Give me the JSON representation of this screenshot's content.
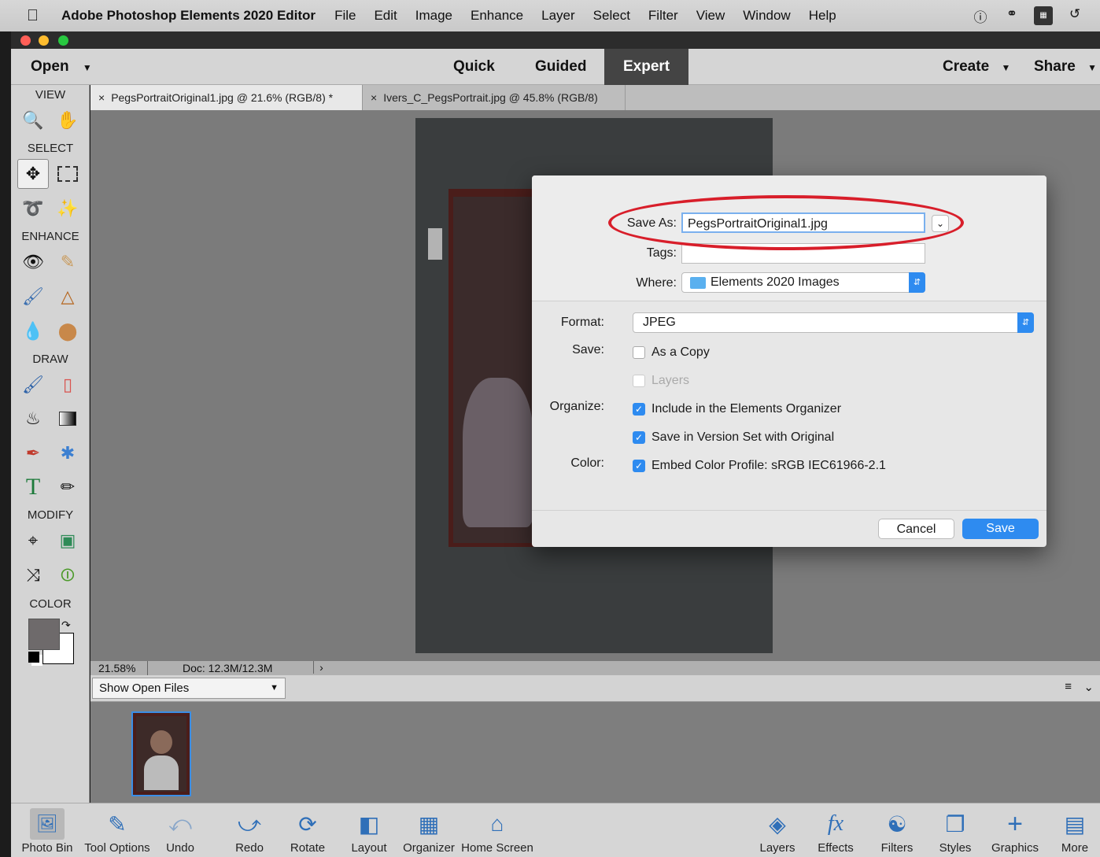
{
  "menubar": {
    "apple_icon": "apple-icon",
    "app_name": "Adobe Photoshop Elements 2020 Editor",
    "items": [
      "File",
      "Edit",
      "Image",
      "Enhance",
      "Layer",
      "Select",
      "Filter",
      "View",
      "Window",
      "Help"
    ],
    "status_icons": [
      "password-icon",
      "creative-cloud-icon",
      "app-icon",
      "time-machine-icon"
    ]
  },
  "window": {
    "traffic_lights": {
      "close": "#ff5f57",
      "minimize": "#febc2e",
      "zoom": "#28c840"
    }
  },
  "modebar": {
    "open_label": "Open",
    "modes": [
      "Quick",
      "Guided",
      "Expert"
    ],
    "active_mode": "Expert",
    "create_label": "Create",
    "share_label": "Share"
  },
  "toolbox": {
    "sections": {
      "view": "VIEW",
      "select": "SELECT",
      "enhance": "ENHANCE",
      "draw": "DRAW",
      "modify": "MODIFY",
      "color": "COLOR"
    },
    "colors": {
      "foreground": "#6e6a6b",
      "background": "#ffffff"
    }
  },
  "tabs": [
    {
      "close": "×",
      "label": "PegsPortraitOriginal1.jpg @ 21.6% (RGB/8) *"
    },
    {
      "close": "×",
      "label": "Ivers_C_PegsPortrait.jpg @ 45.8% (RGB/8)"
    }
  ],
  "status": {
    "zoom": "21.58%",
    "doc": "Doc: 12.3M/12.3M"
  },
  "bin": {
    "dropdown": "Show Open Files"
  },
  "bottombar": {
    "left": [
      "Photo Bin",
      "Tool Options",
      "Undo",
      "Redo",
      "Rotate",
      "Layout",
      "Organizer",
      "Home Screen"
    ],
    "right": [
      "Layers",
      "Effects",
      "Filters",
      "Styles",
      "Graphics",
      "More"
    ]
  },
  "dialog": {
    "save_as_label": "Save As:",
    "save_as_value": "PegsPortraitOriginal1.jpg",
    "tags_label": "Tags:",
    "tags_value": "",
    "where_label": "Where:",
    "where_value": "Elements 2020 Images",
    "format_label": "Format:",
    "format_value": "JPEG",
    "save_label": "Save:",
    "as_copy": {
      "label": "As a Copy",
      "checked": false
    },
    "layers": {
      "label": "Layers",
      "checked": false
    },
    "organize_label": "Organize:",
    "include_organizer": {
      "label": "Include in the Elements Organizer",
      "checked": true
    },
    "version_set": {
      "label": "Save in Version Set with Original",
      "checked": true
    },
    "color_label": "Color:",
    "embed_profile": {
      "label": "Embed Color Profile:  sRGB IEC61966-2.1",
      "checked": true
    },
    "cancel_label": "Cancel",
    "save_button_label": "Save",
    "accent_color": "#2e8bf0"
  },
  "annotation": {
    "color": "#d81e2a"
  }
}
